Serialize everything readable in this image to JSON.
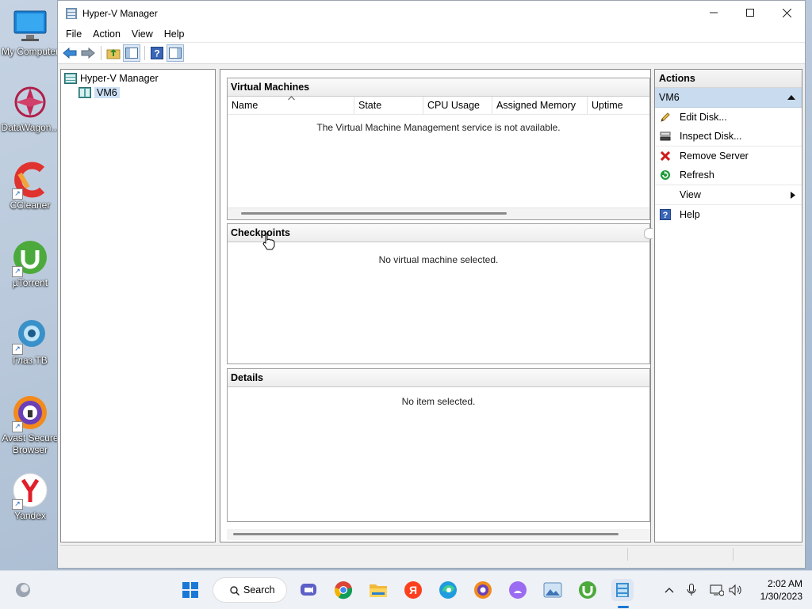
{
  "desktop": {
    "icons": [
      {
        "label": "My Computer"
      },
      {
        "label": "DataWagon..."
      },
      {
        "label": "CCleaner"
      },
      {
        "label": "µTorrent"
      },
      {
        "label": "Глаз.ТВ"
      },
      {
        "label": "Avast Secure Browser"
      },
      {
        "label": "Yandex"
      }
    ]
  },
  "window": {
    "title": "Hyper-V Manager",
    "menu": [
      "File",
      "Action",
      "View",
      "Help"
    ]
  },
  "tree": {
    "root": "Hyper-V Manager",
    "server": "VM6"
  },
  "virtual_machines": {
    "header": "Virtual Machines",
    "columns": [
      "Name",
      "State",
      "CPU Usage",
      "Assigned Memory",
      "Uptime"
    ],
    "message": "The Virtual Machine Management service is not available."
  },
  "checkpoints": {
    "header": "Checkpoints",
    "message": "No virtual machine selected."
  },
  "details": {
    "header": "Details",
    "message": "No item selected."
  },
  "actions": {
    "header": "Actions",
    "section": "VM6",
    "items": [
      "Edit Disk...",
      "Inspect Disk...",
      "Remove Server",
      "Refresh",
      "View",
      "Help"
    ]
  },
  "taskbar": {
    "search_label": "Search",
    "time": "2:02 AM",
    "date": "1/30/2023"
  },
  "colors": {
    "selection": "#c9dbef",
    "accent": "#0a64c8",
    "remove_red": "#d01a1a",
    "refresh_green": "#1d9b3a"
  }
}
